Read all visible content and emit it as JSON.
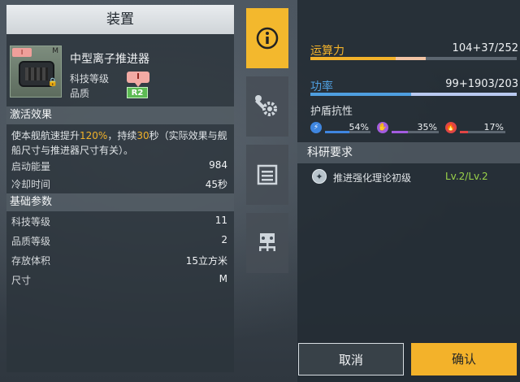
{
  "panel": {
    "title": "装置"
  },
  "item": {
    "name": "中型离子推进器",
    "tech_level_label": "科技等级",
    "quality_label": "品质",
    "tech_badge": "I",
    "quality_badge": "R2",
    "size_letter": "M"
  },
  "activation": {
    "header": "激活效果",
    "desc_prefix": "使本舰航速提升",
    "desc_pct": "120%",
    "desc_mid": "，持续",
    "desc_sec": "30",
    "desc_suffix": "秒（实际效果与舰船尺寸与推进器尺寸有关）。",
    "stats": [
      {
        "label": "启动能量",
        "value": "984"
      },
      {
        "label": "冷却时间",
        "value": "45秒"
      }
    ]
  },
  "basic": {
    "header": "基础参数",
    "stats": [
      {
        "label": "科技等级",
        "value": "11"
      },
      {
        "label": "品质等级",
        "value": "2"
      },
      {
        "label": "存放体积",
        "value": "15立方米"
      },
      {
        "label": "尺寸",
        "value": "M"
      }
    ]
  },
  "tabs": [
    {
      "name": "info",
      "icon": "info-icon",
      "active": true
    },
    {
      "name": "modules",
      "icon": "wrench-gear-icon",
      "active": false
    },
    {
      "name": "list",
      "icon": "list-icon",
      "active": false
    },
    {
      "name": "network",
      "icon": "network-icon",
      "active": false
    }
  ],
  "computing": {
    "label": "运算力",
    "value": "104+37/252",
    "base": 104,
    "add": 37,
    "max": 252,
    "color": "#f3b22a"
  },
  "power": {
    "label": "功率",
    "value": "99+1903/203",
    "base": 99,
    "add": 1903,
    "max": 203,
    "color": "#4f9fe0"
  },
  "shield": {
    "title": "护盾抗性",
    "items": [
      {
        "icon": "lightning-icon",
        "value": "54%",
        "fraction": 0.54,
        "color": "#3f86e0"
      },
      {
        "icon": "hand-icon",
        "value": "35%",
        "fraction": 0.35,
        "color": "#a35ce0"
      },
      {
        "icon": "flame-icon",
        "value": "17%",
        "fraction": 0.17,
        "color": "#e04545"
      }
    ]
  },
  "research": {
    "header": "科研要求",
    "items": [
      {
        "name": "推进强化理论初级",
        "level": "Lv.2/Lv.2"
      }
    ]
  },
  "buttons": {
    "cancel": "取消",
    "confirm": "确认"
  }
}
